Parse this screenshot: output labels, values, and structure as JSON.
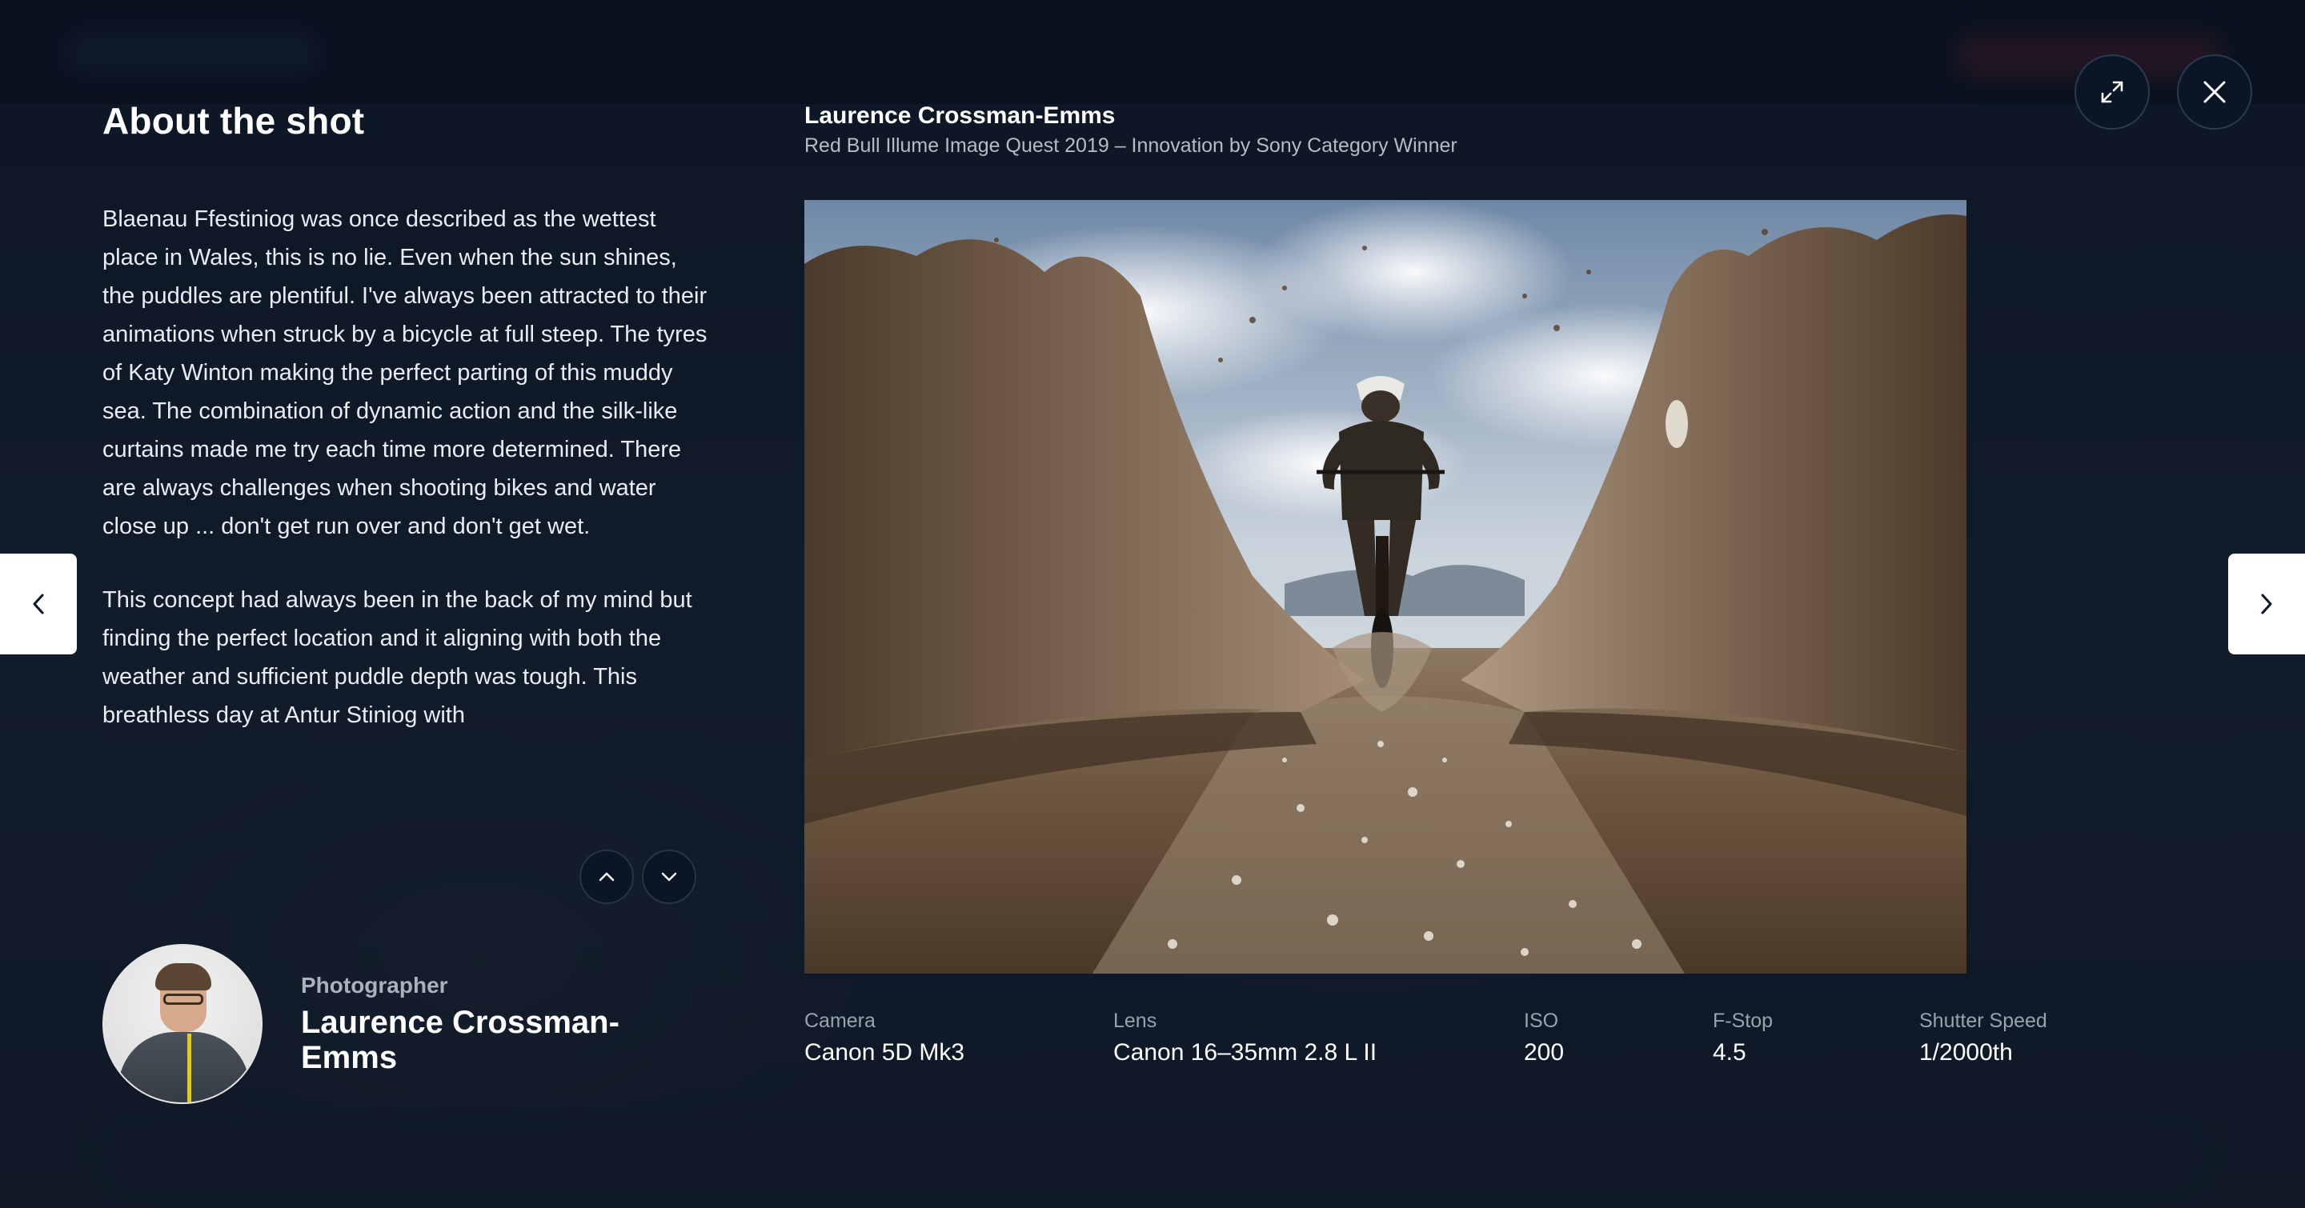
{
  "about": {
    "title": "About the shot",
    "paragraphs": [
      "Blaenau Ffestiniog was once described as the wettest place in Wales, this is no lie. Even when the sun shines, the puddles are plentiful. I've always been attracted to their animations when struck by a bicycle at full steep. The tyres of Katy Winton making the perfect parting of this muddy sea. The combination of dynamic action and the silk-like curtains made me try each time more determined. There are always challenges when shooting bikes and water close up ... don't get run over and don't get wet.",
      "This concept had always been in the back of my mind but finding the perfect location and it aligning with both the weather and sufficient puddle depth was tough. This breathless day at Antur Stiniog with"
    ]
  },
  "photographer": {
    "role": "Photographer",
    "name": "Laurence Crossman-Emms"
  },
  "shot": {
    "title": "Laurence Crossman-Emms",
    "subtitle": "Red Bull Illume Image Quest 2019 – Innovation by Sony Category Winner"
  },
  "meta": {
    "camera": {
      "label": "Camera",
      "value": "Canon 5D Mk3"
    },
    "lens": {
      "label": "Lens",
      "value": "Canon 16–35mm 2.8 L II"
    },
    "iso": {
      "label": "ISO",
      "value": "200"
    },
    "fstop": {
      "label": "F-Stop",
      "value": "4.5"
    },
    "shutter": {
      "label": "Shutter Speed",
      "value": "1/2000th"
    }
  },
  "icons": {
    "expand": "expand-icon",
    "close": "close-icon",
    "prev": "chevron-left-icon",
    "next": "chevron-right-icon",
    "scroll_up": "chevron-up-icon",
    "scroll_down": "chevron-down-icon"
  }
}
